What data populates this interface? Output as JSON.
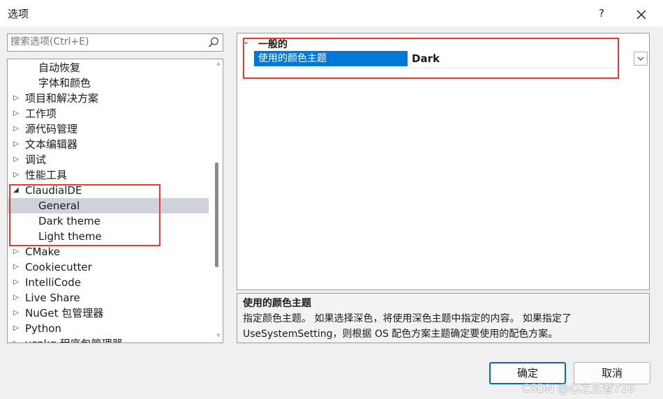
{
  "window": {
    "title": "选项",
    "help_label": "?"
  },
  "search": {
    "placeholder": "搜索选项(Ctrl+E)"
  },
  "tree": {
    "items": [
      {
        "label": "自动恢复",
        "expander": "",
        "level": 2
      },
      {
        "label": "字体和颜色",
        "expander": "",
        "level": 2
      },
      {
        "label": "项目和解决方案",
        "expander": "▷",
        "level": 1
      },
      {
        "label": "工作项",
        "expander": "▷",
        "level": 1
      },
      {
        "label": "源代码管理",
        "expander": "▷",
        "level": 1
      },
      {
        "label": "文本编辑器",
        "expander": "▷",
        "level": 1
      },
      {
        "label": "调试",
        "expander": "▷",
        "level": 1
      },
      {
        "label": "性能工具",
        "expander": "▷",
        "level": 1
      },
      {
        "label": "ClaudialDE",
        "expander": "◢",
        "level": 1
      },
      {
        "label": "General",
        "expander": "",
        "level": 2,
        "selected": true
      },
      {
        "label": "Dark theme",
        "expander": "",
        "level": 2
      },
      {
        "label": "Light theme",
        "expander": "",
        "level": 2
      },
      {
        "label": "CMake",
        "expander": "▷",
        "level": 1
      },
      {
        "label": "Cookiecutter",
        "expander": "▷",
        "level": 1
      },
      {
        "label": "IntelliCode",
        "expander": "▷",
        "level": 1
      },
      {
        "label": "Live Share",
        "expander": "▷",
        "level": 1
      },
      {
        "label": "NuGet 包管理器",
        "expander": "▷",
        "level": 1
      },
      {
        "label": "Python",
        "expander": "▷",
        "level": 1
      },
      {
        "label": "vcpkg 程序包管理器",
        "expander": "▷",
        "level": 1
      }
    ]
  },
  "property_grid": {
    "category": "一般的",
    "property_name": "使用的颜色主题",
    "property_value": "Dark"
  },
  "description": {
    "title": "使用的颜色主题",
    "text": "指定颜色主题。 如果选择深色，将使用深色主题中指定的内容。 如果指定了 UseSystemSetting，则根据 OS 配色方案主题确定要使用的配色方案。"
  },
  "buttons": {
    "ok": "确定",
    "cancel": "取消"
  },
  "watermark": "CSDN @心之王者716",
  "colors": {
    "selection_blue": "#0078d7",
    "highlight_red": "#e53935",
    "tree_selected": "#cfd1db"
  }
}
